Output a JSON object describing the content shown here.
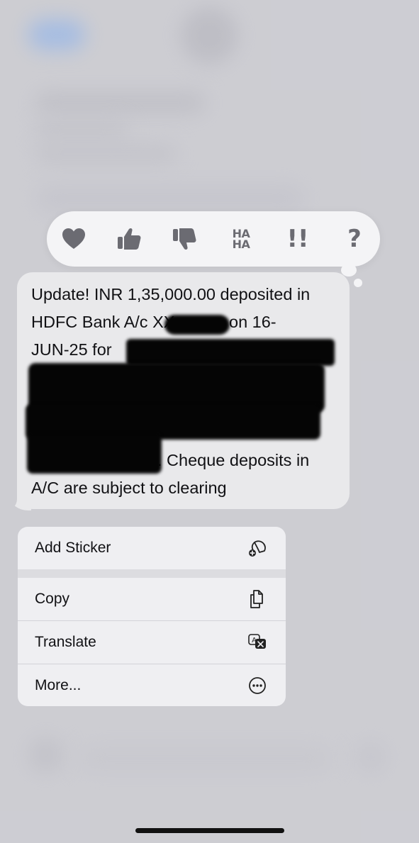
{
  "tapback": {
    "items": [
      {
        "name": "heart",
        "label": "heart"
      },
      {
        "name": "thumbs-up",
        "label": "like"
      },
      {
        "name": "thumbs-down",
        "label": "dislike"
      },
      {
        "name": "haha",
        "label_top": "HA",
        "label_bottom": "HA"
      },
      {
        "name": "emphasize",
        "label": "!!"
      },
      {
        "name": "question",
        "label": "?"
      }
    ]
  },
  "message": {
    "lines": [
      "Update! INR 1,35,000.00 deposited in",
      "HDFC Bank A/c XX",
      "on 16-",
      "JUN-25 for",
      ". Cheque deposits in",
      "A/C are subject to clearing"
    ]
  },
  "menu": {
    "items": [
      {
        "label": "Add Sticker",
        "icon": "add-sticker-icon"
      },
      {
        "label": "Copy",
        "icon": "copy-icon"
      },
      {
        "label": "Translate",
        "icon": "translate-icon"
      },
      {
        "label": "More...",
        "icon": "more-icon"
      }
    ]
  },
  "colors": {
    "backdrop": "#cdcdd2",
    "bubble": "#e9e9eb",
    "menu": "#efeff2",
    "tapback_icon": "#6b6b72"
  }
}
